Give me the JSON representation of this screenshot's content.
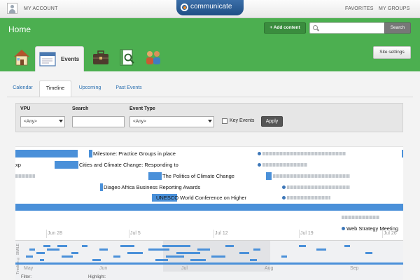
{
  "topbar": {
    "my_account": "MY ACCOUNT",
    "logo": "communicate",
    "favorites": "FAVORITES",
    "my_groups": "MY GROUPS"
  },
  "header": {
    "title": "Home",
    "add_content": "+ Add content",
    "search_button": "Search",
    "site_settings": "Site settings",
    "active_section": "Events",
    "nav_icons": [
      "home-icon",
      "events-icon",
      "briefcase-icon",
      "search-document-icon",
      "people-icon"
    ]
  },
  "tabs": [
    {
      "label": "Calendar",
      "active": false
    },
    {
      "label": "Timeline",
      "active": true
    },
    {
      "label": "Upcoming",
      "active": false
    },
    {
      "label": "Past Events",
      "active": false
    }
  ],
  "filters": {
    "vpu_label": "VPU",
    "vpu_value": "<Any>",
    "search_label": "Search",
    "search_value": "",
    "event_type_label": "Event Type",
    "event_type_value": "<Any>",
    "key_events_label": "Key Events",
    "key_events_checked": false,
    "apply": "Apply"
  },
  "timeline": {
    "events": [
      {
        "label": "Milestone: Practice Groups in place"
      },
      {
        "label": "xp"
      },
      {
        "label": "Cities and Climate Change: Responding to"
      },
      {
        "label": "The Politics of Climate Change"
      },
      {
        "label": "Diageo Africa Business Reporting Awards"
      },
      {
        "label": "UNESCO World Conference on Higher"
      },
      {
        "label": "Web Strategy Meeting"
      }
    ],
    "ticks": [
      "Jun 28",
      "Jul 5",
      "Jul 12",
      "Jul 19",
      "Jul 26"
    ],
    "overview_ticks": [
      "May",
      "Jun",
      "Jul",
      "Aug",
      "Sep"
    ],
    "overview_caption": "Timeline © SIMILE"
  },
  "footer": {
    "filter_label": "Filter:",
    "highlight_label": "Highlight:"
  },
  "colors": {
    "header_green": "#4caf50",
    "event_blue": "#4a90d9",
    "logo_blue": "#2a5d96"
  }
}
